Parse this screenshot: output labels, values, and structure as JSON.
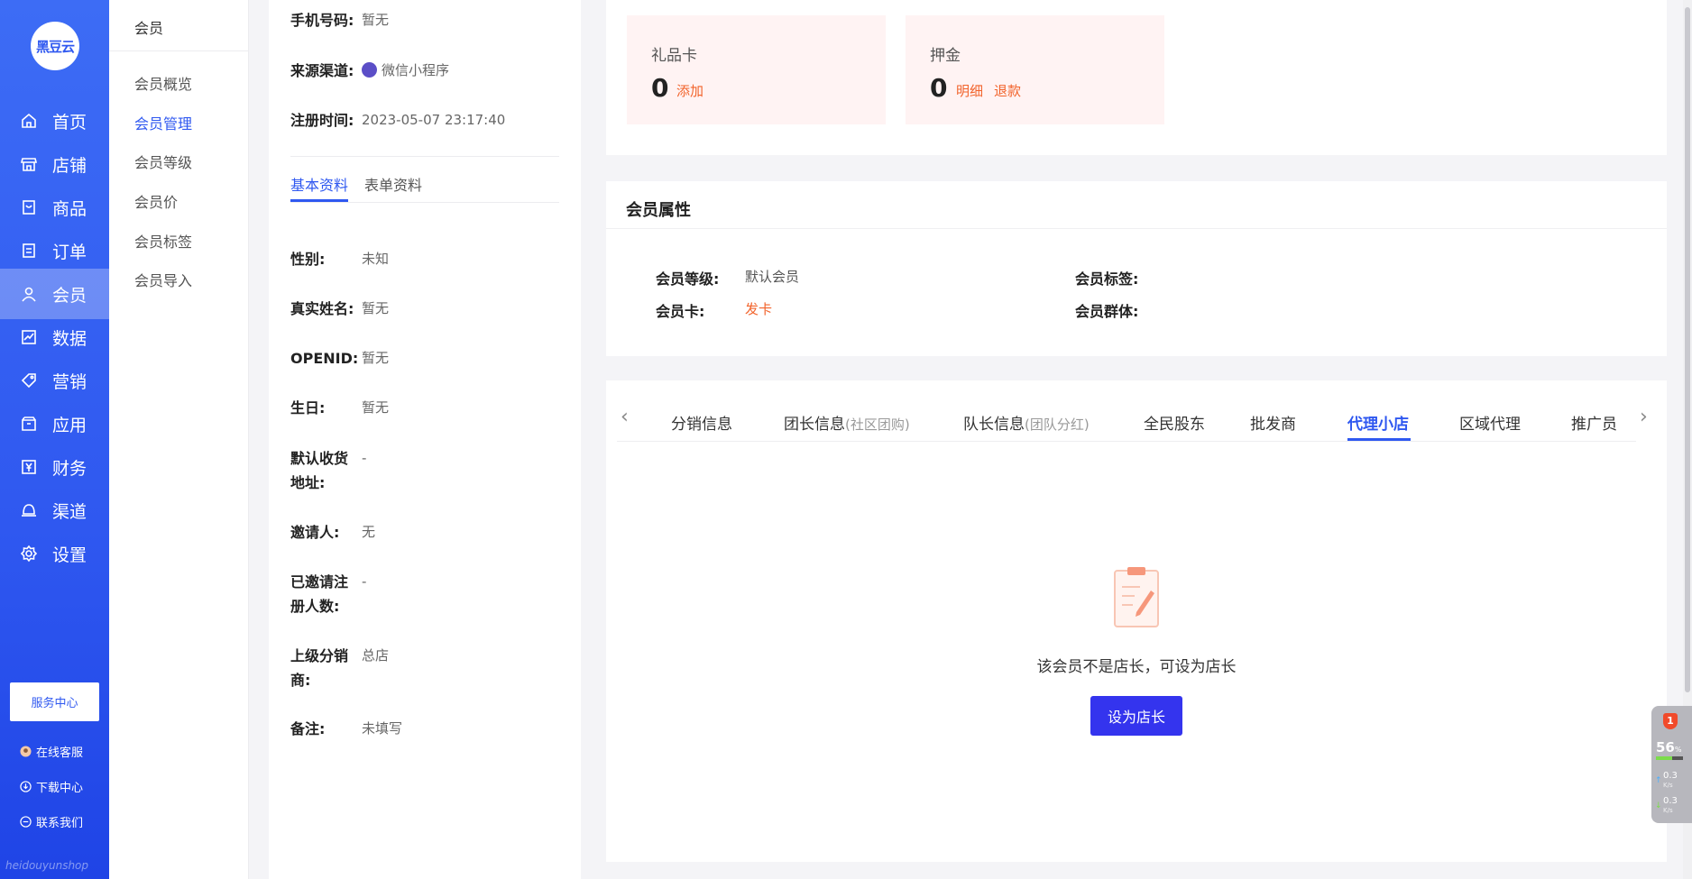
{
  "logo": {
    "text": "黑豆云"
  },
  "nav": {
    "items": [
      {
        "label": "首页",
        "icon": "home-icon",
        "active": false
      },
      {
        "label": "店铺",
        "icon": "store-icon",
        "active": false
      },
      {
        "label": "商品",
        "icon": "product-icon",
        "active": false
      },
      {
        "label": "订单",
        "icon": "order-icon",
        "active": false
      },
      {
        "label": "会员",
        "icon": "user-icon",
        "active": true
      },
      {
        "label": "数据",
        "icon": "chart-icon",
        "active": false
      },
      {
        "label": "营销",
        "icon": "tag-icon",
        "active": false
      },
      {
        "label": "应用",
        "icon": "app-box-icon",
        "active": false
      },
      {
        "label": "财务",
        "icon": "yen-icon",
        "active": false
      },
      {
        "label": "渠道",
        "icon": "channel-icon",
        "active": false
      },
      {
        "label": "设置",
        "icon": "gear-icon",
        "active": false
      }
    ],
    "service_center": "服务中心",
    "online_service": "在线客服",
    "download_center": "下载中心",
    "contact_us": "联系我们",
    "brand_footer": "heidouyunshop"
  },
  "submenu": {
    "title": "会员",
    "items": [
      "会员概览",
      "会员管理",
      "会员等级",
      "会员价",
      "会员标签",
      "会员导入"
    ],
    "active_index": 1
  },
  "detail": {
    "top": [
      {
        "key": "手机号码:",
        "value": "暂无"
      },
      {
        "key": "来源渠道:",
        "value": "微信小程序"
      },
      {
        "key": "注册时间:",
        "value": "2023-05-07 23:17:40"
      }
    ],
    "tabs": [
      "基本资料",
      "表单资料"
    ],
    "fields": [
      {
        "key": "性别:",
        "value": "未知"
      },
      {
        "key": "真实姓名:",
        "value": "暂无"
      },
      {
        "key": "OPENID:",
        "value": "暂无"
      },
      {
        "key": "生日:",
        "value": "暂无"
      },
      {
        "key": "默认收货",
        "key2": "地址:",
        "value": "-"
      },
      {
        "key": "邀请人:",
        "value": "无"
      },
      {
        "key": "已邀请注",
        "key2": "册人数:",
        "value": "-"
      },
      {
        "key": "上级分销",
        "key2": "商:",
        "value": "总店"
      },
      {
        "key": "备注:",
        "value": "未填写"
      }
    ]
  },
  "cards": {
    "gift": {
      "title": "礼品卡",
      "count": "0",
      "action1": "添加"
    },
    "deposit": {
      "title": "押金",
      "count": "0",
      "action1": "明细",
      "action2": "退款"
    }
  },
  "attributes": {
    "title": "会员属性",
    "level_label": "会员等级:",
    "level_value": "默认会员",
    "card_label": "会员卡:",
    "card_value": "发卡",
    "tag_label": "会员标签:",
    "group_label": "会员群体:"
  },
  "panel": {
    "tabs": [
      {
        "label": "分销信息",
        "sub": ""
      },
      {
        "label": "团长信息",
        "sub": "(社区团购)"
      },
      {
        "label": "队长信息",
        "sub": "(团队分红)"
      },
      {
        "label": "全民股东",
        "sub": ""
      },
      {
        "label": "批发商",
        "sub": ""
      },
      {
        "label": "代理小店",
        "sub": ""
      },
      {
        "label": "区域代理",
        "sub": ""
      },
      {
        "label": "推广员",
        "sub": ""
      }
    ],
    "active_tab": 5,
    "empty_message": "该会员不是店长，可设为店长",
    "action_button": "设为店长"
  },
  "widget": {
    "badge": "1",
    "percent": "56",
    "percent_unit": "%",
    "up_speed": "0.3",
    "down_speed": "0.3",
    "speed_unit": "K/s"
  },
  "colors": {
    "primary": "#2f58f0",
    "accent_orange": "#f2632b",
    "button": "#3434ee"
  }
}
